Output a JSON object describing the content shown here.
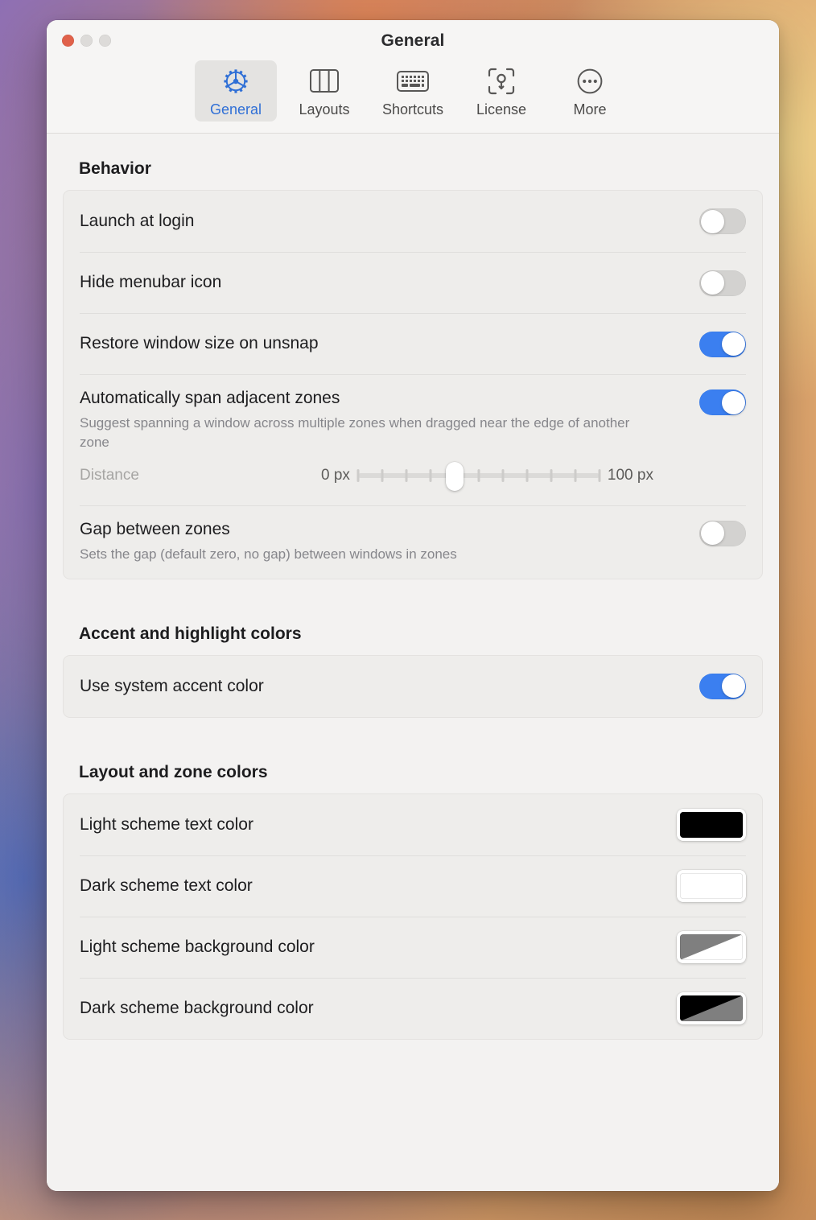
{
  "window": {
    "title": "General",
    "traffic_lights": [
      "close",
      "minimize",
      "zoom"
    ]
  },
  "toolbar": {
    "items": [
      {
        "label": "General",
        "icon": "gear-icon",
        "selected": true
      },
      {
        "label": "Layouts",
        "icon": "columns-icon",
        "selected": false
      },
      {
        "label": "Shortcuts",
        "icon": "keyboard-icon",
        "selected": false
      },
      {
        "label": "License",
        "icon": "key-scan-icon",
        "selected": false
      },
      {
        "label": "More",
        "icon": "ellipsis-circle-icon",
        "selected": false
      }
    ]
  },
  "sections": {
    "behavior": {
      "title": "Behavior",
      "rows": {
        "launch_at_login": {
          "title": "Launch at login",
          "toggle": "off"
        },
        "hide_menubar": {
          "title": "Hide menubar icon",
          "toggle": "off"
        },
        "restore_size": {
          "title": "Restore window size on unsnap",
          "toggle": "on"
        },
        "span_zones": {
          "title": "Automatically span adjacent zones",
          "subtitle": "Suggest spanning a window across multiple zones when dragged near the edge of another zone",
          "toggle": "on"
        },
        "distance_slider": {
          "label": "Distance",
          "min_label": "0 px",
          "max_label": "100 px",
          "min": 0,
          "max": 100,
          "value": 40,
          "tick_count": 11,
          "enabled": false
        },
        "gap_between_zones": {
          "title": "Gap between zones",
          "subtitle": "Sets the gap (default zero, no gap) between windows in zones",
          "toggle": "off"
        }
      }
    },
    "accent": {
      "title": "Accent and highlight colors",
      "rows": {
        "use_system_accent": {
          "title": "Use system accent color",
          "toggle": "on"
        }
      }
    },
    "layout_colors": {
      "title": "Layout and zone colors",
      "rows": [
        {
          "title": "Light scheme text color",
          "swatch_type": "solid",
          "color": "#000000"
        },
        {
          "title": "Dark scheme text color",
          "swatch_type": "solid",
          "color": "#ffffff"
        },
        {
          "title": "Light scheme background color",
          "swatch_type": "diagonal",
          "color": "#7f7f7f",
          "color2": "#ffffff"
        },
        {
          "title": "Dark scheme background color",
          "swatch_type": "diagonal",
          "color": "#000000",
          "color2": "#7f7f7f"
        }
      ]
    }
  },
  "theme": {
    "accent": "#3b7ff0",
    "selected_tab_text": "#2f6fd6",
    "window_bg": "#f3f2f1",
    "group_bg": "#eeedeb"
  }
}
